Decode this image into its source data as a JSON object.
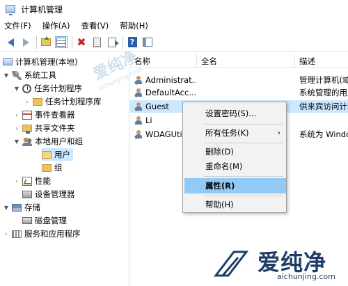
{
  "window": {
    "title": "计算机管理"
  },
  "menubar": {
    "items": [
      "文件(F)",
      "操作(A)",
      "查看(V)",
      "帮助(H)"
    ]
  },
  "toolbar": {
    "icons": [
      "back-arrow-icon",
      "forward-arrow-icon",
      "folder-up-icon",
      "show-hide-tree-icon",
      "delete-x-icon",
      "properties-icon",
      "export-list-icon",
      "help-icon",
      "view-pane-icon"
    ]
  },
  "tree": {
    "root": "计算机管理(本地)",
    "system_tools": "系统工具",
    "task_scheduler": "任务计划程序",
    "task_scheduler_library": "任务计划程序库",
    "event_viewer": "事件查看器",
    "shared_folders": "共享文件夹",
    "local_users_groups": "本地用户和组",
    "users": "用户",
    "groups": "组",
    "performance": "性能",
    "device_manager": "设备管理器",
    "storage": "存储",
    "disk_management": "磁盘管理",
    "services_apps": "服务和应用程序"
  },
  "list": {
    "columns": [
      "名称",
      "全名",
      "描述"
    ],
    "rows": [
      {
        "name": "Administrat...",
        "fullname": "",
        "desc": "管理计算机(域"
      },
      {
        "name": "DefaultAcc...",
        "fullname": "",
        "desc": "系统管理的用户"
      },
      {
        "name": "Guest",
        "fullname": "",
        "desc": "供来宾访问计算"
      },
      {
        "name": "Li",
        "fullname": "",
        "desc": ""
      },
      {
        "name": "WDAGUti",
        "fullname": "",
        "desc": "系统为 Windo"
      }
    ]
  },
  "context_menu": {
    "set_password": "设置密码(S)...",
    "all_tasks": "所有任务(K)",
    "submenu_arrow": "›",
    "delete": "删除(D)",
    "rename": "重命名(M)",
    "properties": "属性(R)",
    "help": "帮助(H)"
  },
  "watermark": {
    "center_text": "爱纯净",
    "center_url": "aichunjing.com",
    "brand_text": "爱纯净",
    "brand_url": "aichunjing.com"
  },
  "colors": {
    "selection": "#cce8ff",
    "menu_highlight": "#91c9f7",
    "brand": "#1f3d66"
  }
}
